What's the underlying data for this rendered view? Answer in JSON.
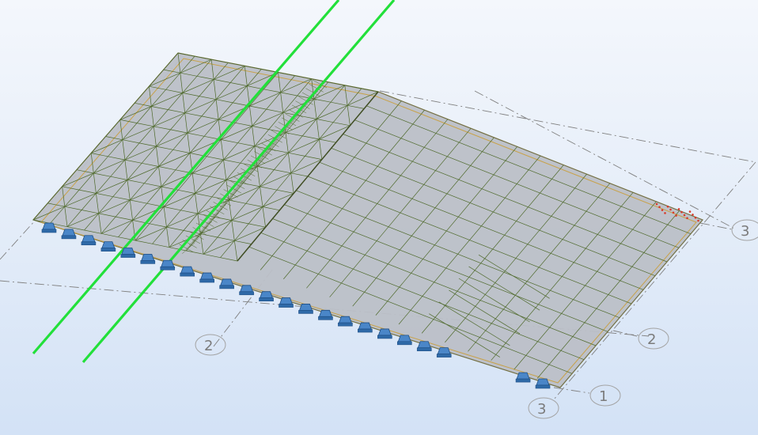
{
  "view": {
    "background_top": "#f4f7fc",
    "background_bottom": "#d3e2f6",
    "slab_fill": "#bcc0c8",
    "mesh_color": "#4f6a2c",
    "edge_color": "#c8a24a",
    "support_color": "#3f7fc2",
    "cable_color": "#22e03a",
    "gridline_color": "#7a7a7a"
  },
  "grid_labels": [
    "3",
    "2",
    "2",
    "1",
    "3"
  ],
  "supports_count": 26
}
